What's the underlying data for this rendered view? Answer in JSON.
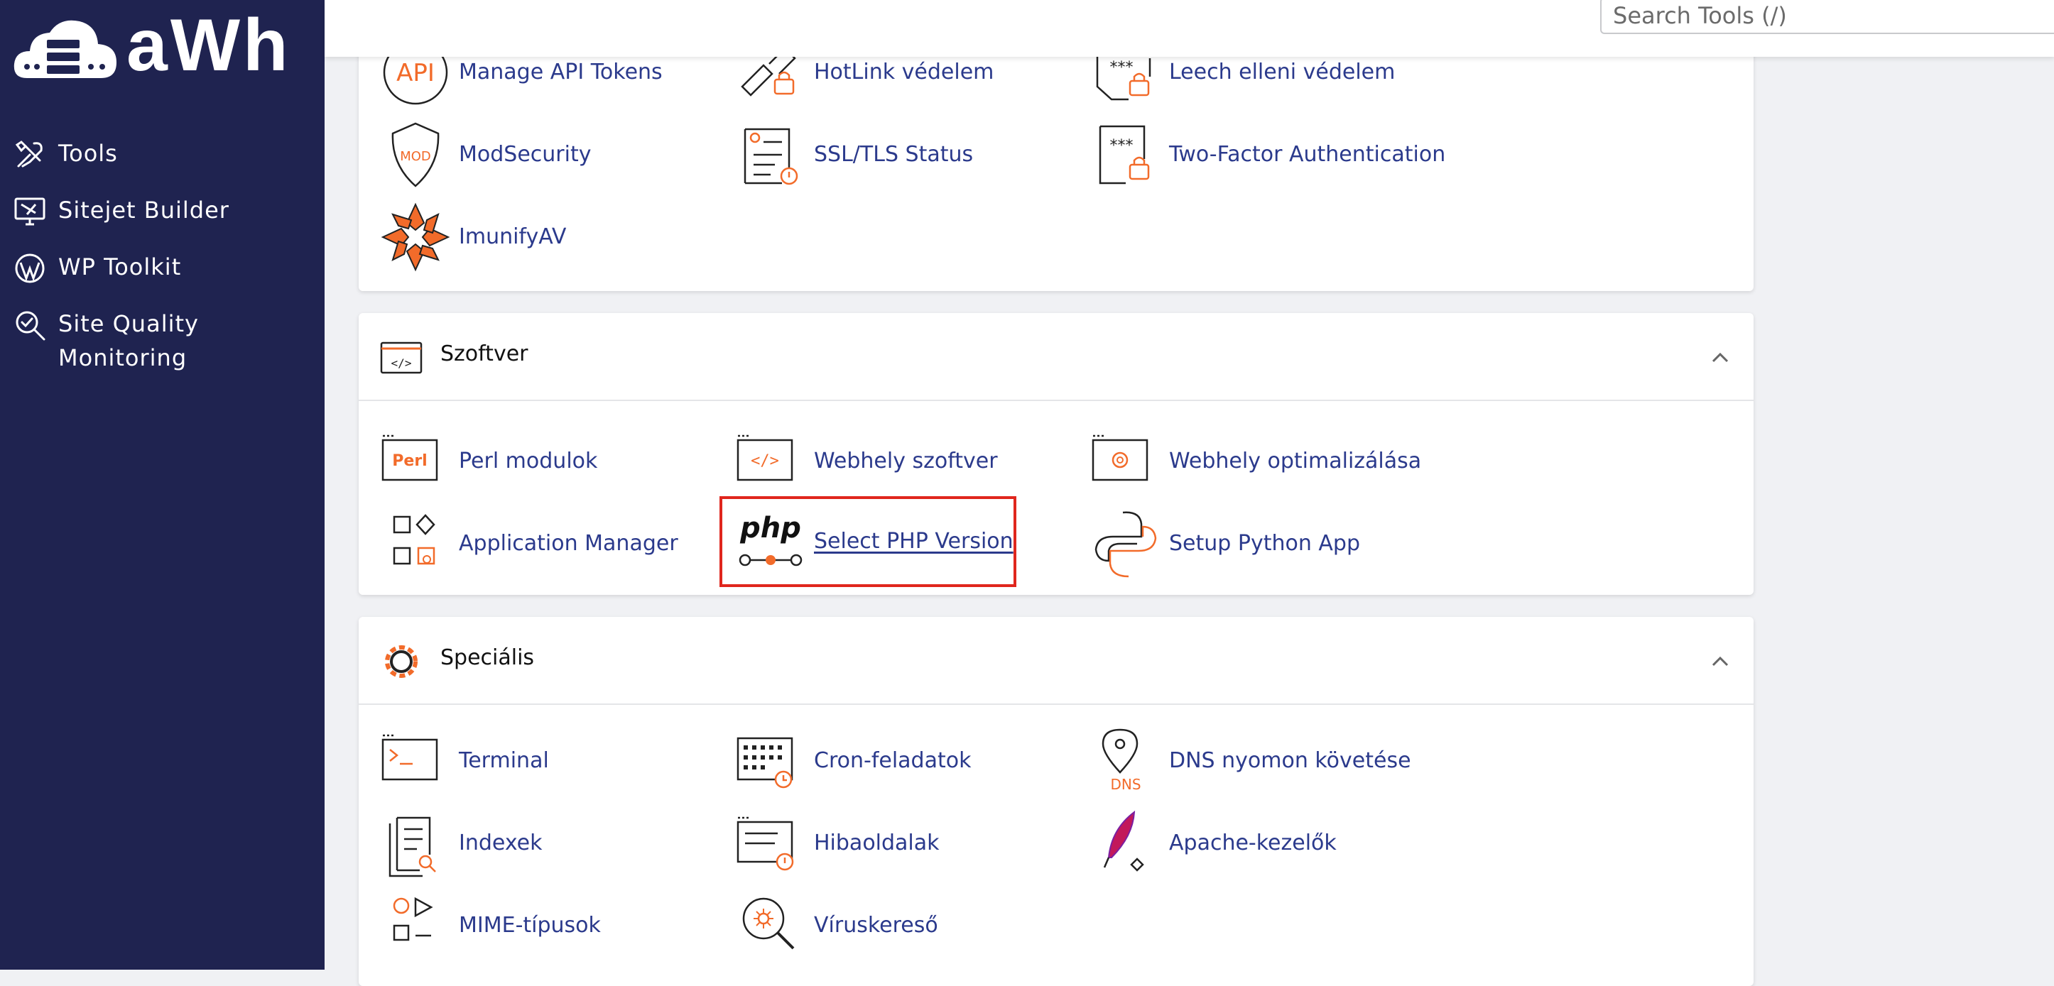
{
  "brand": {
    "logo_text": "aWh"
  },
  "sidebar": {
    "items": [
      {
        "label": "Tools",
        "icon": "tools-icon"
      },
      {
        "label": "Sitejet Builder",
        "icon": "sitejet-icon"
      },
      {
        "label": "WP Toolkit",
        "icon": "wordpress-icon"
      },
      {
        "label": "Site Quality Monitoring",
        "icon": "site-quality-icon"
      }
    ]
  },
  "topbar": {
    "search_placeholder": "Search Tools (/)"
  },
  "security": {
    "items": [
      {
        "label": "Manage API Tokens",
        "icon": "api-icon"
      },
      {
        "label": "HotLink védelem",
        "icon": "hotlink-icon"
      },
      {
        "label": "Leech elleni védelem",
        "icon": "leech-icon"
      },
      {
        "label": "ModSecurity",
        "icon": "modsecurity-icon"
      },
      {
        "label": "SSL/TLS Status",
        "icon": "ssl-status-icon"
      },
      {
        "label": "Two-Factor Authentication",
        "icon": "two-factor-icon"
      },
      {
        "label": "ImunifyAV",
        "icon": "imunify-icon"
      }
    ]
  },
  "software": {
    "title": "Szoftver",
    "items": [
      {
        "label": "Perl modulok",
        "icon": "perl-icon",
        "icon_text": "Perl"
      },
      {
        "label": "Webhely szoftver",
        "icon": "site-software-icon"
      },
      {
        "label": "Webhely optimalizálása",
        "icon": "site-optimize-icon"
      },
      {
        "label": "Application Manager",
        "icon": "app-manager-icon"
      },
      {
        "label": "Select PHP Version",
        "icon": "php-icon",
        "icon_text": "php"
      },
      {
        "label": "Setup Python App",
        "icon": "python-icon"
      }
    ]
  },
  "special": {
    "title": "Speciális",
    "items": [
      {
        "label": "Terminal",
        "icon": "terminal-icon"
      },
      {
        "label": "Cron-feladatok",
        "icon": "cron-icon"
      },
      {
        "label": "DNS nyomon követése",
        "icon": "dns-icon",
        "icon_text": "DNS"
      },
      {
        "label": "Indexek",
        "icon": "indexes-icon"
      },
      {
        "label": "Hibaoldalak",
        "icon": "error-pages-icon"
      },
      {
        "label": "Apache-kezelők",
        "icon": "apache-icon"
      },
      {
        "label": "MIME-típusok",
        "icon": "mime-icon"
      },
      {
        "label": "Víruskereső",
        "icon": "virus-scanner-icon"
      }
    ]
  },
  "colors": {
    "sidebar_bg": "#1f2350",
    "accent": "#f26b2a",
    "link": "#2b3a8c",
    "highlight": "#e0261d"
  }
}
